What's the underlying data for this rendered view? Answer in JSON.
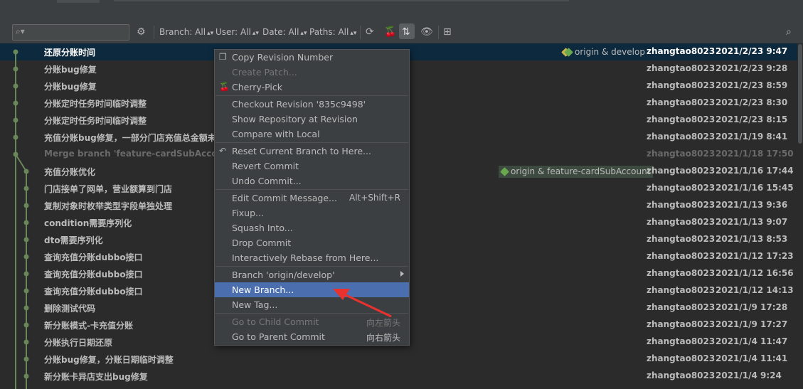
{
  "toolbar": {
    "filters": [
      "Branch: All",
      "User: All",
      "Date: All",
      "Paths: All"
    ]
  },
  "commits": [
    {
      "message": "还原分账时间",
      "author": "zhangtao8023",
      "date": "2021/2/23 9:47",
      "refs": "origin & develop"
    },
    {
      "message": "分账bug修复",
      "author": "zhangtao8023",
      "date": "2021/2/23 9:28"
    },
    {
      "message": "分账bug修复",
      "author": "zhangtao8023",
      "date": "2021/2/23 8:59"
    },
    {
      "message": "分账定时任务时间临时调整",
      "author": "zhangtao8023",
      "date": "2021/2/23 8:30"
    },
    {
      "message": "分账定时任务时间临时调整",
      "author": "zhangtao8023",
      "date": "2021/2/23 8:15"
    },
    {
      "message": "充值分账bug修复，一部分门店充值总金额未",
      "author": "zhangtao8023",
      "date": "2021/1/19 8:41"
    },
    {
      "message": "Merge branch 'feature-cardSubAccount",
      "author": "zhangtao8023",
      "date": "2021/1/18 17:50"
    },
    {
      "message": "充值分账优化",
      "author": "zhangtao8023",
      "date": "2021/1/16 17:44",
      "refs": "origin & feature-cardSubAccount"
    },
    {
      "message": "门店接单了网单，营业额算到门店",
      "author": "zhangtao8023",
      "date": "2021/1/16 15:45"
    },
    {
      "message": "复制对象时枚举类型字段单独处理",
      "author": "zhangtao8023",
      "date": "2021/1/13 9:36"
    },
    {
      "message": "condition需要序列化",
      "author": "zhangtao8023",
      "date": "2021/1/13 9:07"
    },
    {
      "message": "dto需要序列化",
      "author": "zhangtao8023",
      "date": "2021/1/13 8:53"
    },
    {
      "message": "查询充值分账dubbo接口",
      "author": "zhangtao8023",
      "date": "2021/1/12 17:23"
    },
    {
      "message": "查询充值分账dubbo接口",
      "author": "zhangtao8023",
      "date": "2021/1/12 16:56"
    },
    {
      "message": "查询充值分账dubbo接口",
      "author": "zhangtao8023",
      "date": "2021/1/12 14:13"
    },
    {
      "message": "删除测试代码",
      "author": "zhangtao8023",
      "date": "2021/1/9 17:28"
    },
    {
      "message": "新分账模式-卡充值分账",
      "author": "zhangtao8023",
      "date": "2021/1/9 17:27"
    },
    {
      "message": "分账执行日期还原",
      "author": "zhangtao8023",
      "date": "2021/1/4 11:47"
    },
    {
      "message": "分账bug修复，分账日期临时调整",
      "author": "zhangtao8023",
      "date": "2021/1/4 11:41"
    },
    {
      "message": "新分账卡异店支出bug修复",
      "author": "zhangtao8023",
      "date": "2021/1/4 9:24"
    }
  ],
  "context_menu": {
    "items": [
      {
        "label": "Copy Revision Number",
        "icon": "copy-icon"
      },
      {
        "label": "Create Patch...",
        "disabled": true
      },
      {
        "label": "Cherry-Pick",
        "icon": "cherry-icon"
      },
      {
        "label": "Checkout Revision '835c9498'"
      },
      {
        "label": "Show Repository at Revision"
      },
      {
        "label": "Compare with Local"
      },
      {
        "label": "Reset Current Branch to Here...",
        "icon": "undo-icon"
      },
      {
        "label": "Revert Commit"
      },
      {
        "label": "Undo Commit..."
      },
      {
        "label": "Edit Commit Message...",
        "shortcut": "Alt+Shift+R"
      },
      {
        "label": "Fixup..."
      },
      {
        "label": "Squash Into..."
      },
      {
        "label": "Drop Commit"
      },
      {
        "label": "Interactively Rebase from Here..."
      },
      {
        "label": "Branch 'origin/develop'",
        "submenu": true
      },
      {
        "label": "New Branch...",
        "highlighted": true
      },
      {
        "label": "New Tag..."
      },
      {
        "label": "Go to Child Commit",
        "shortcut": "向左箭头",
        "disabled": true
      },
      {
        "label": "Go to Parent Commit",
        "shortcut": "向右箭头"
      }
    ]
  },
  "colors": {
    "background": "#2b2b2b",
    "selected_row": "#0d293e",
    "menu_highlight": "#4b6eaf",
    "graph_green": "#6a8759",
    "annotation_arrow": "#e8322e"
  }
}
